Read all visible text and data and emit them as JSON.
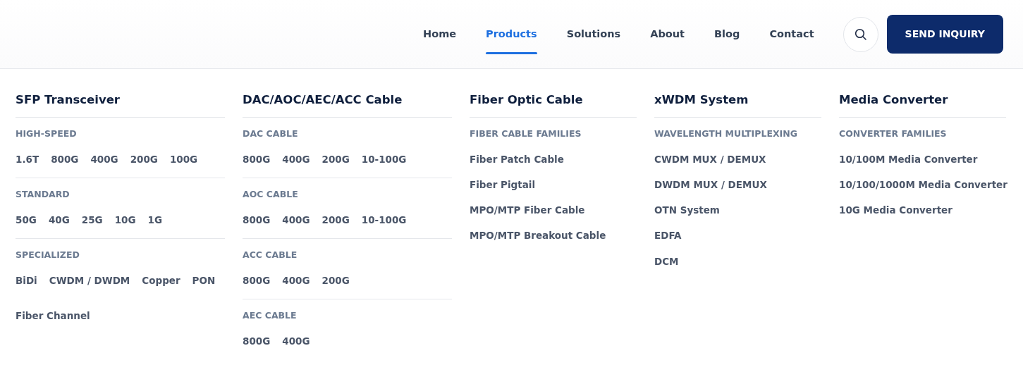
{
  "nav": [
    {
      "label": "Home",
      "selected": false
    },
    {
      "label": "Products",
      "selected": true
    },
    {
      "label": "Solutions",
      "selected": false
    },
    {
      "label": "About",
      "selected": false
    },
    {
      "label": "Blog",
      "selected": false
    },
    {
      "label": "Contact",
      "selected": false
    }
  ],
  "cta": "SEND INQUIRY",
  "columns": [
    {
      "title": "SFP Transceiver",
      "groups": [
        {
          "kind": "inline",
          "heading": "HIGH-SPEED",
          "links": [
            "1.6T",
            "800G",
            "400G",
            "200G",
            "100G"
          ]
        },
        {
          "kind": "inline",
          "heading": "STANDARD",
          "links": [
            "50G",
            "40G",
            "25G",
            "10G",
            "1G"
          ]
        },
        {
          "kind": "inline",
          "heading": "SPECIALIZED",
          "links": [
            "BiDi",
            "CWDM / DWDM",
            "Copper",
            "PON",
            "Fiber Channel"
          ]
        }
      ]
    },
    {
      "title": "DAC/AOC/AEC/ACC Cable",
      "groups": [
        {
          "kind": "inline",
          "heading": "DAC CABLE",
          "links": [
            "800G",
            "400G",
            "200G",
            "10-100G"
          ]
        },
        {
          "kind": "inline",
          "heading": "AOC CABLE",
          "links": [
            "800G",
            "400G",
            "200G",
            "10-100G"
          ]
        },
        {
          "kind": "inline",
          "heading": "ACC CABLE",
          "links": [
            "800G",
            "400G",
            "200G"
          ]
        },
        {
          "kind": "inline",
          "heading": "AEC CABLE",
          "links": [
            "800G",
            "400G"
          ]
        }
      ]
    },
    {
      "title": "Fiber Optic Cable",
      "groups": [
        {
          "kind": "stack",
          "heading": "FIBER CABLE FAMILIES",
          "links": [
            "Fiber Patch Cable",
            "Fiber Pigtail",
            "MPO/MTP Fiber Cable",
            "MPO/MTP Breakout Cable"
          ]
        }
      ]
    },
    {
      "title": "xWDM System",
      "groups": [
        {
          "kind": "stack",
          "heading": "WAVELENGTH MULTIPLEXING",
          "links": [
            "CWDM MUX / DEMUX",
            "DWDM MUX / DEMUX",
            "OTN System",
            "EDFA",
            "DCM"
          ]
        }
      ]
    },
    {
      "title": "Media Converter",
      "groups": [
        {
          "kind": "stack",
          "heading": "CONVERTER FAMILIES",
          "links": [
            "10/100M Media Converter",
            "10/100/1000M Media Converter",
            "10G Media Converter"
          ]
        }
      ]
    }
  ]
}
